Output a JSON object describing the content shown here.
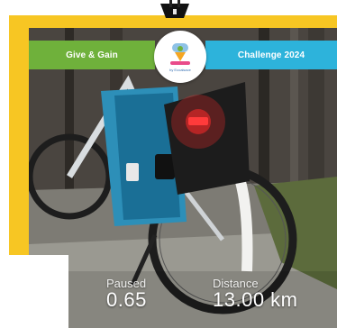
{
  "banner": {
    "left_text": "Give & Gain",
    "right_text": "Challenge 2024",
    "left_color": "#6fb13b",
    "right_color": "#2db3db",
    "badge_icon": "challenge-logo-icon",
    "badge_text": "by Ecoalsace"
  },
  "stats": {
    "paused_label": "Paused",
    "paused_value": "0.65",
    "distance_label": "Distance",
    "distance_value": "13.00 km"
  },
  "colors": {
    "frame": "#f7c623"
  }
}
